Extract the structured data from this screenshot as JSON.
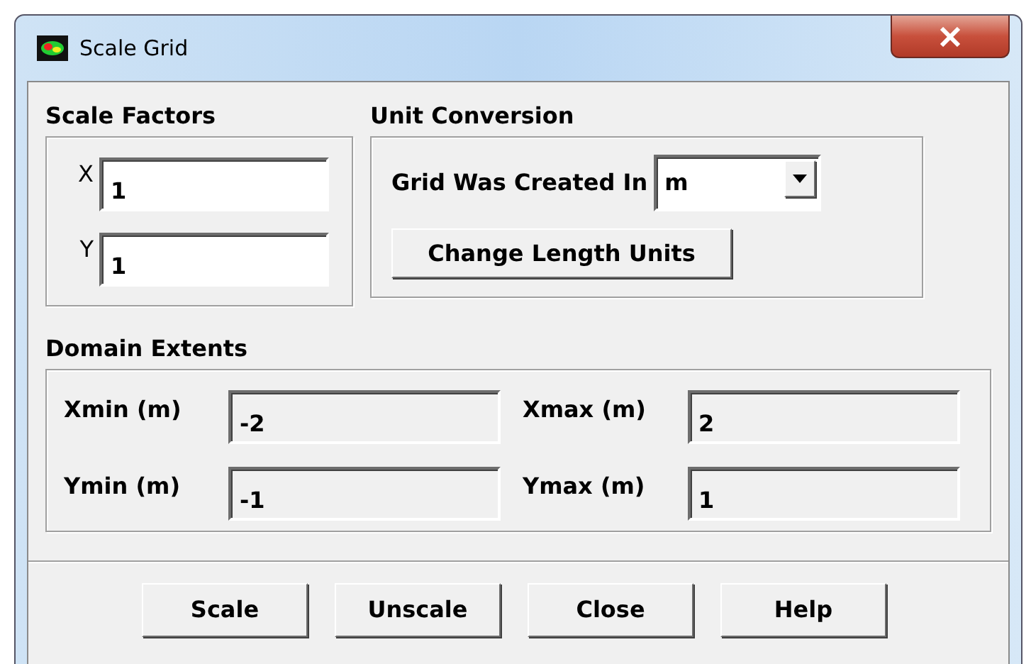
{
  "window": {
    "title": "Scale Grid"
  },
  "scale_factors": {
    "title": "Scale Factors",
    "fields": [
      {
        "label": "X",
        "value": "1"
      },
      {
        "label": "Y",
        "value": "1"
      }
    ]
  },
  "unit_conversion": {
    "title": "Unit Conversion",
    "created_in_label": "Grid Was Created In",
    "created_in_value": "m",
    "change_button": "Change Length Units"
  },
  "domain_extents": {
    "title": "Domain Extents",
    "fields": [
      {
        "label": "Xmin (m)",
        "value": "-2",
        "disabled": true
      },
      {
        "label": "Xmax (m)",
        "value": "2",
        "disabled": true
      },
      {
        "label": "Ymin (m)",
        "value": "-1",
        "disabled": true
      },
      {
        "label": "Ymax (m)",
        "value": "1",
        "disabled": true
      }
    ]
  },
  "buttons": [
    "Scale",
    "Unscale",
    "Close",
    "Help"
  ]
}
